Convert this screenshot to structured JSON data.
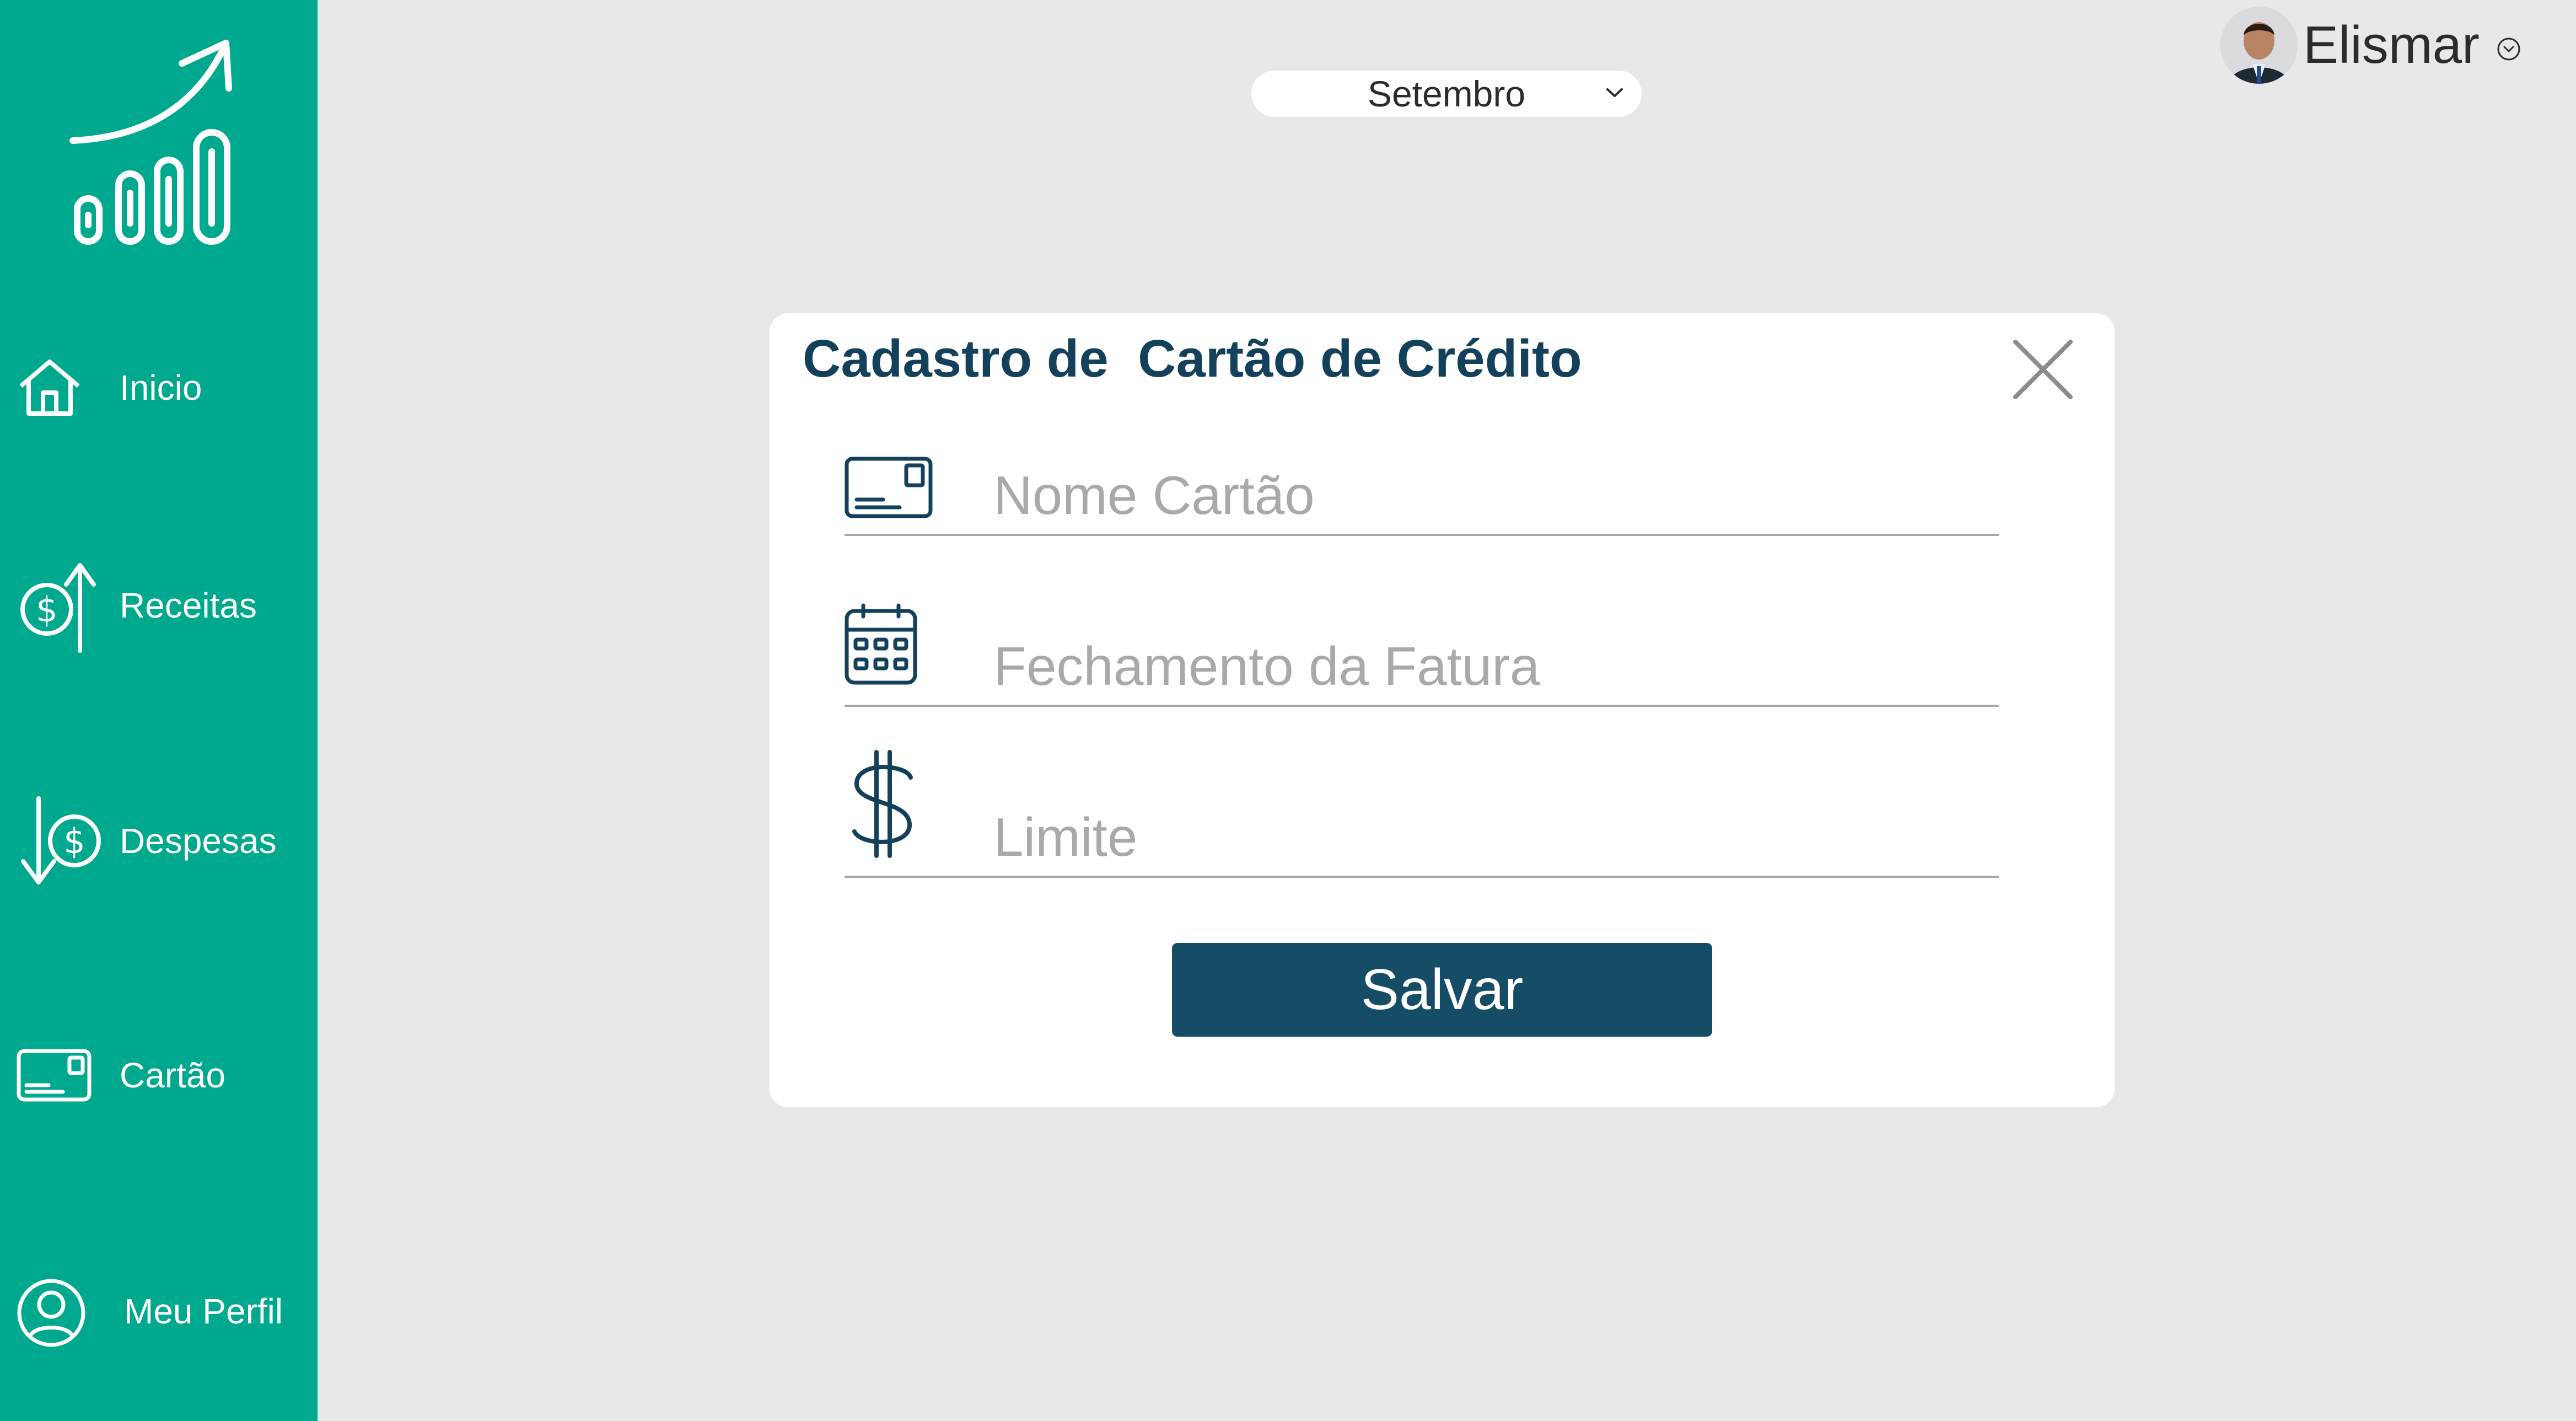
{
  "colors": {
    "sidebar": "#00a88e",
    "background": "#e7e8ea",
    "primary": "#154d66",
    "title": "#13405a",
    "placeholder": "#a9a9a9"
  },
  "sidebar": {
    "logo_icon": "growth-chart-icon",
    "items": [
      {
        "label": "Inicio",
        "icon": "home-icon"
      },
      {
        "label": "Receitas",
        "icon": "income-icon"
      },
      {
        "label": "Despesas",
        "icon": "expense-icon"
      },
      {
        "label": "Cartão",
        "icon": "credit-card-icon"
      },
      {
        "label": "Meu Perfil",
        "icon": "user-profile-icon"
      }
    ]
  },
  "header": {
    "month": "Setembro",
    "user": {
      "name": "Elismar"
    }
  },
  "modal": {
    "title": "Cadastro de  Cartão de Crédito",
    "fields": [
      {
        "placeholder": "Nome Cartão",
        "value": "",
        "icon": "credit-card-icon"
      },
      {
        "placeholder": "Fechamento da Fatura",
        "value": "",
        "icon": "calendar-icon"
      },
      {
        "placeholder": "Limite",
        "value": "",
        "icon": "dollar-icon"
      }
    ],
    "save_label": "Salvar"
  }
}
